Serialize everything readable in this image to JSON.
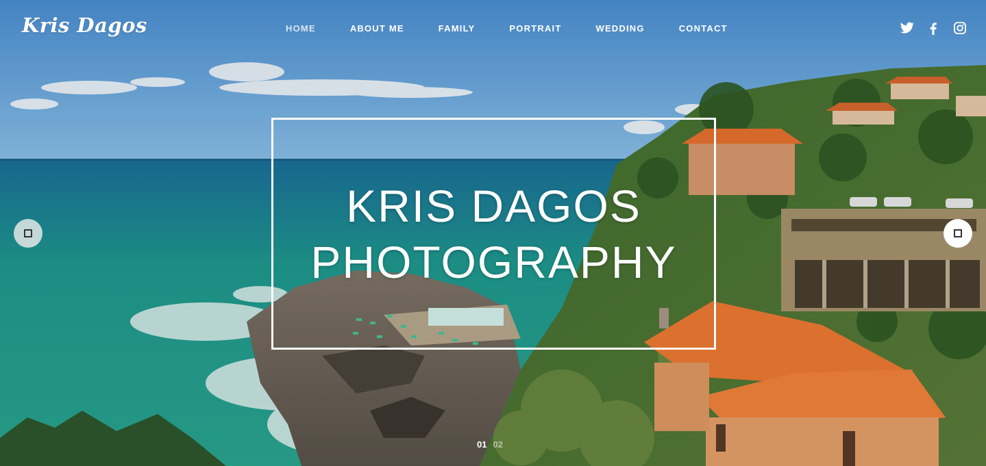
{
  "site": {
    "logo": "Kris Dagos"
  },
  "nav": {
    "items": [
      {
        "label": "HOME",
        "active": true
      },
      {
        "label": "ABOUT ME",
        "active": false
      },
      {
        "label": "FAMILY",
        "active": false
      },
      {
        "label": "PORTRAIT",
        "active": false
      },
      {
        "label": "WEDDING",
        "active": false
      },
      {
        "label": "CONTACT",
        "active": false
      }
    ]
  },
  "social": {
    "icons": [
      "twitter-icon",
      "facebook-icon",
      "instagram-icon"
    ]
  },
  "hero": {
    "title_line1": "KRIS DAGOS",
    "title_line2": "PHOTOGRAPHY",
    "background": "coastal-village-sea-photo"
  },
  "slider": {
    "prev_icon": "square-icon",
    "next_icon": "square-icon",
    "pages": [
      "01",
      "02"
    ],
    "current_page": "01"
  },
  "colors": {
    "sky": "#5a9fd6",
    "sea": "#1f9a8f",
    "roof": "#f07a36",
    "text": "#ffffff"
  }
}
